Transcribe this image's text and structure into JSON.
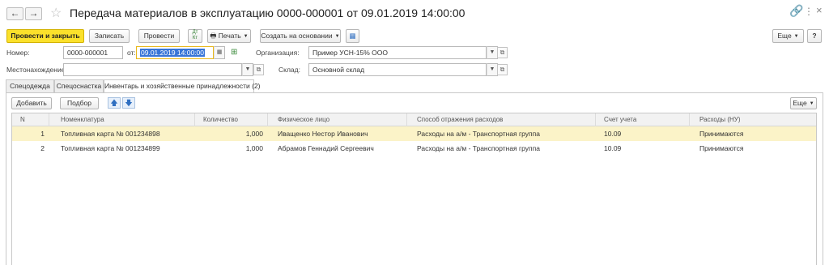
{
  "window": {
    "title": "Передача материалов в эксплуатацию 0000-000001 от 09.01.2019 14:00:00"
  },
  "toolbar": {
    "post_close": "Провести и закрыть",
    "save": "Записать",
    "post": "Провести",
    "print": "Печать",
    "create_based": "Создать на основании",
    "more": "Еще",
    "help": "?"
  },
  "form": {
    "number_label": "Номер:",
    "number_value": "0000-000001",
    "date_label": "от:",
    "date_value": "09.01.2019 14:00:00",
    "org_label": "Организация:",
    "org_value": "Пример УСН-15% ООО",
    "location_label": "Местонахождение:",
    "location_value": "",
    "warehouse_label": "Склад:",
    "warehouse_value": "Основной склад"
  },
  "tabs": [
    {
      "label": "Спецодежда",
      "active": false
    },
    {
      "label": "Спецоснастка",
      "active": false
    },
    {
      "label": "Инвентарь и хозяйственные принадлежности (2)",
      "active": true
    }
  ],
  "table_toolbar": {
    "add": "Добавить",
    "select": "Подбор",
    "more": "Еще"
  },
  "table": {
    "columns": [
      "N",
      "Номенклатура",
      "Количество",
      "Физическое лицо",
      "Способ отражения расходов",
      "Счет учета",
      "Расходы (НУ)"
    ],
    "rows": [
      {
        "n": "1",
        "item": "Топливная карта № 001234898",
        "qty": "1,000",
        "person": "Иващенко Нестор Иванович",
        "method": "Расходы на а/м - Транспортная группа",
        "account": "10.09",
        "expense": "Принимаются"
      },
      {
        "n": "2",
        "item": "Топливная карта № 001234899",
        "qty": "1,000",
        "person": "Абрамов Геннадий Сергеевич",
        "method": "Расходы на а/м - Транспортная группа",
        "account": "10.09",
        "expense": "Принимаются"
      }
    ]
  }
}
